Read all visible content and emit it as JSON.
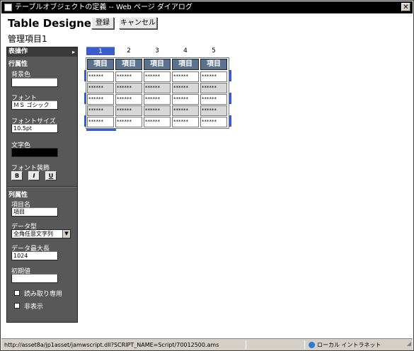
{
  "window": {
    "title": "テーブルオブジェクトの定義 -- Web ページ ダイアログ",
    "close_glyph": "✕"
  },
  "header": {
    "app_title": "Table Designer",
    "register_label": "登録",
    "cancel_label": "キャンセル",
    "subtitle": "管理項目1"
  },
  "panel": {
    "table_ops": "表操作",
    "table_ops_arrow": "▸",
    "row_section": "行属性",
    "bg_color_label": "背景色",
    "bg_color_value": "",
    "font_label": "フォント",
    "font_value": "ＭＳ ゴシック",
    "font_size_label": "フォントサイズ",
    "font_size_value": "10.5pt",
    "text_color_label": "文字色",
    "text_color_value": "#000000",
    "font_style_label": "フォント装飾",
    "bold": "B",
    "italic": "I",
    "underline": "U",
    "col_section": "列属性",
    "item_name_label": "項目名",
    "item_name_value": "項目",
    "data_type_label": "データ型",
    "data_type_value": "全角任意文字列",
    "max_len_label": "データ最大長",
    "max_len_value": "1024",
    "initial_label": "初期値",
    "initial_value": "",
    "readonly_label": "読み取り専用",
    "hidden_label": "非表示"
  },
  "grid": {
    "col_numbers": [
      "1",
      "2",
      "3",
      "4",
      "5"
    ],
    "selected_col": "1",
    "headers": [
      "項目",
      "項目",
      "項目",
      "項目",
      "項目"
    ],
    "rows": [
      [
        "******",
        "******",
        "******",
        "******",
        "******"
      ],
      [
        "******",
        "******",
        "******",
        "******",
        "******"
      ],
      [
        "******",
        "******",
        "******",
        "******",
        "******"
      ],
      [
        "******",
        "******",
        "******",
        "******",
        "******"
      ],
      [
        "******",
        "******",
        "******",
        "******",
        "******"
      ]
    ],
    "accent": "#3a5ccf",
    "header_bg": "#5a7190"
  },
  "statusbar": {
    "url": "http://asset8a/jp1asset/jamwscript.dll?SCRIPT_NAME=Script/70012500.ams",
    "zone": "ローカル イントラネット"
  }
}
